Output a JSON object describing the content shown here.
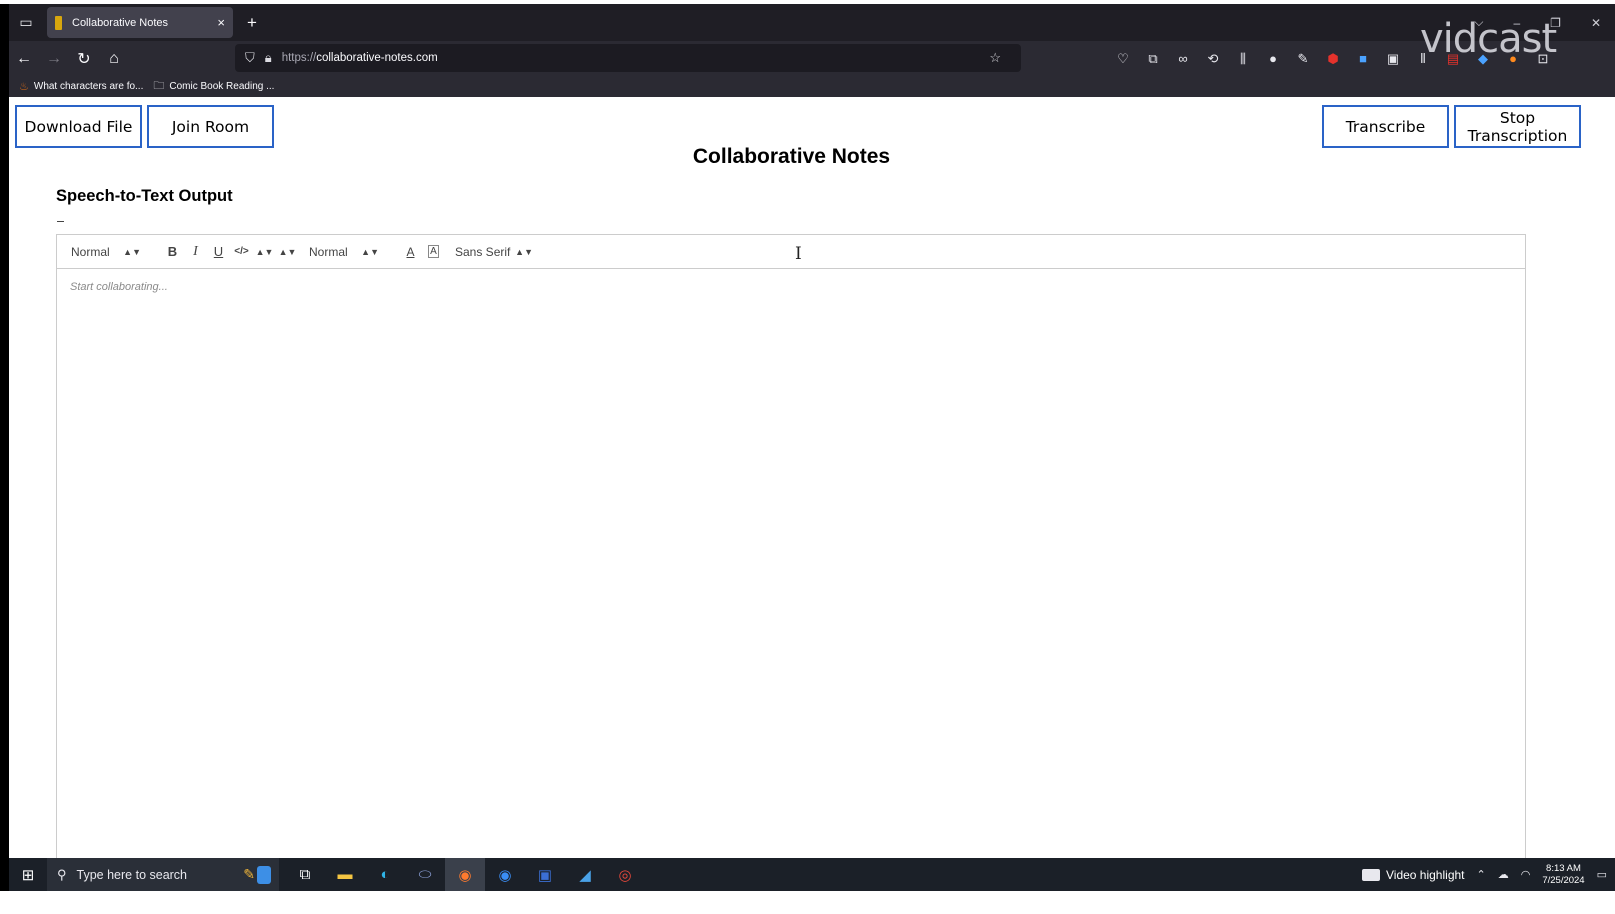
{
  "browser": {
    "tab": {
      "title": "Collaborative Notes",
      "close": "×"
    },
    "new_tab": "+",
    "url": {
      "scheme": "https://",
      "host": "collaborative-notes.com"
    },
    "bookmarks": [
      {
        "label": "What characters are fo..."
      },
      {
        "label": "Comic Book Reading ..."
      }
    ],
    "watermark": "vidcast"
  },
  "page": {
    "buttons": {
      "download": "Download File",
      "join": "Join Room",
      "transcribe": "Transcribe",
      "stop": "Stop Transcription"
    },
    "title": "Collaborative Notes",
    "section_title": "Speech-to-Text Output",
    "editor": {
      "header_picker": "Normal",
      "size_picker": "Normal",
      "font_picker": "Sans Serif",
      "bold": "B",
      "italic": "I",
      "underline": "U",
      "code": "</>",
      "color": "A",
      "background": "A",
      "placeholder": "Start collaborating..."
    }
  },
  "taskbar": {
    "search_placeholder": "Type here to search",
    "video_highlight": "Video highlight",
    "time": "8:13 AM",
    "date": "7/25/2024"
  }
}
